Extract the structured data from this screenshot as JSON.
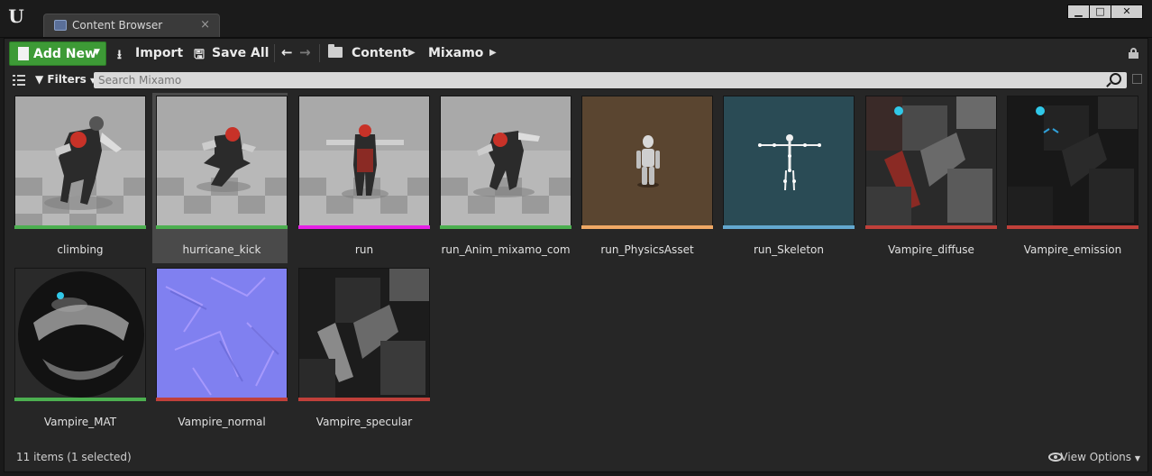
{
  "window": {
    "tab_label": "Content Browser",
    "tab_close": "×",
    "controls": [
      "▁",
      "□",
      "✕"
    ]
  },
  "toolbar": {
    "add_new_label": "Add New",
    "import_label": "Import",
    "save_all_label": "Save All",
    "breadcrumbs": [
      "Content",
      "Mixamo"
    ]
  },
  "filter_bar": {
    "filters_label": "Filters",
    "search_placeholder": "Search Mixamo"
  },
  "assets": [
    {
      "name": "climbing",
      "type_color": "#4caf50",
      "selected": false,
      "thumb": "character"
    },
    {
      "name": "hurricane_kick",
      "type_color": "#4caf50",
      "selected": true,
      "thumb": "character"
    },
    {
      "name": "run",
      "type_color": "#e520e5",
      "selected": false,
      "thumb": "character"
    },
    {
      "name": "run_Anim_mixamo_com",
      "type_color": "#4caf50",
      "selected": false,
      "thumb": "character"
    },
    {
      "name": "run_PhysicsAsset",
      "type_color": "#f0a865",
      "selected": false,
      "thumb": "physics"
    },
    {
      "name": "run_Skeleton",
      "type_color": "#63a8cf",
      "selected": false,
      "thumb": "skeleton"
    },
    {
      "name": "Vampire_diffuse",
      "type_color": "#c0403a",
      "selected": false,
      "thumb": "texture_color"
    },
    {
      "name": "Vampire_emission",
      "type_color": "#c0403a",
      "selected": false,
      "thumb": "texture_dark"
    },
    {
      "name": "Vampire_MAT",
      "type_color": "#4caf50",
      "selected": false,
      "thumb": "material"
    },
    {
      "name": "Vampire_normal",
      "type_color": "#c0403a",
      "selected": false,
      "thumb": "normal"
    },
    {
      "name": "Vampire_specular",
      "type_color": "#c0403a",
      "selected": false,
      "thumb": "texture_gray"
    }
  ],
  "status": {
    "item_count": "11 items (1 selected)",
    "view_options_label": "View Options"
  }
}
